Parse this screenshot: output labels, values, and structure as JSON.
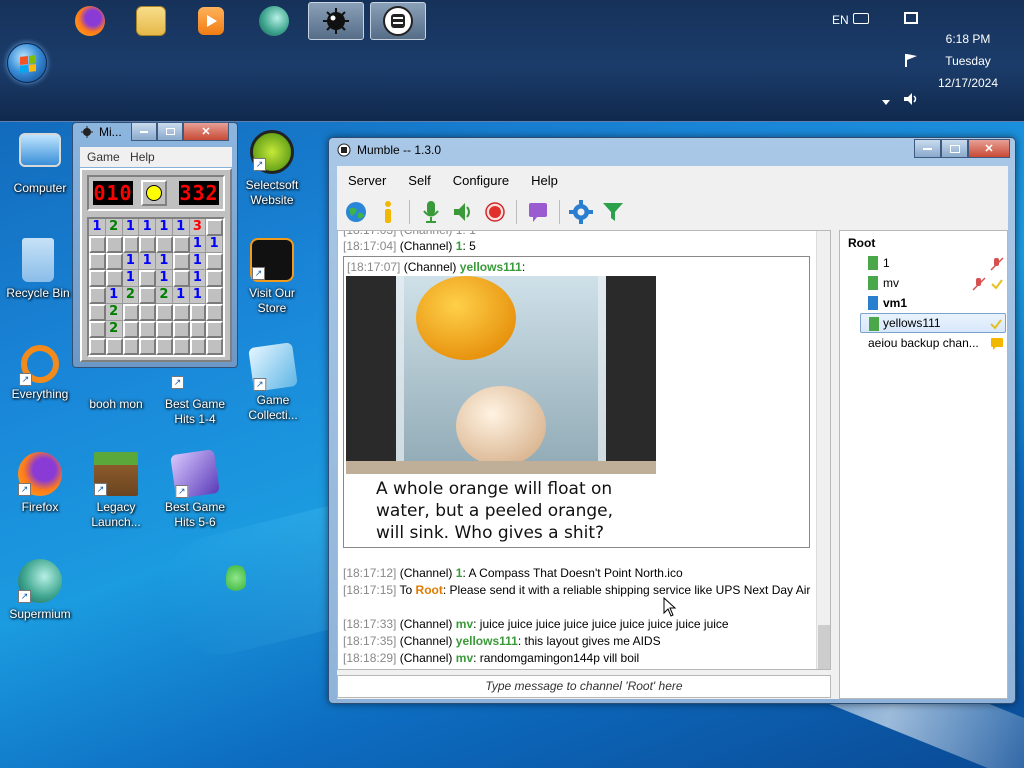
{
  "taskbar": {
    "pinned": [
      {
        "name": "firefox",
        "icon": "firefox-icon"
      },
      {
        "name": "file-explorer",
        "icon": "folder-icon"
      },
      {
        "name": "media-player",
        "icon": "media-player-icon"
      },
      {
        "name": "supermium",
        "icon": "supermium-icon"
      },
      {
        "name": "minesweeper",
        "icon": "mine-icon"
      },
      {
        "name": "mumble",
        "icon": "mumble-icon"
      }
    ],
    "language": "EN",
    "clock": {
      "time": "6:18 PM",
      "day": "Tuesday",
      "date": "12/17/2024"
    }
  },
  "desktop": {
    "icons": [
      {
        "label": "Computer"
      },
      {
        "label": "Recycle Bin"
      },
      {
        "label": "Everything"
      },
      {
        "label": "Firefox"
      },
      {
        "label": "Supermium"
      },
      {
        "label": "Selectsoft Website"
      },
      {
        "label": "Visit Our Store"
      },
      {
        "label": "booh mon"
      },
      {
        "label": "Best Game Hits 1-4"
      },
      {
        "label": "Game Collecti..."
      },
      {
        "label": "Legacy Launch..."
      },
      {
        "label": "Best Game Hits 5-6"
      }
    ]
  },
  "minesweeper": {
    "title": "Mi...",
    "menu": [
      "Game",
      "Help"
    ],
    "mines_left": "010",
    "timer": "332",
    "grid": [
      [
        "1",
        "2",
        "1",
        "1",
        "1",
        "1",
        "3",
        ""
      ],
      [
        "",
        "",
        "",
        "",
        "",
        "",
        "1",
        "1"
      ],
      [
        "",
        "",
        "1",
        "1",
        "1",
        "",
        "1",
        ""
      ],
      [
        "",
        "",
        "1",
        "",
        "1",
        "",
        "1",
        ""
      ],
      [
        "",
        "1",
        "2",
        "",
        "2",
        "1",
        "1",
        ""
      ],
      [
        "",
        "2",
        "",
        "",
        "",
        "",
        "",
        ""
      ],
      [
        "",
        "2",
        "",
        "",
        "",
        "",
        "",
        ""
      ],
      [
        "",
        "",
        "",
        "",
        "",
        "",
        "",
        ""
      ]
    ],
    "closed": [
      [
        0,
        0,
        0,
        0,
        0,
        0,
        0,
        1
      ],
      [
        1,
        1,
        1,
        1,
        1,
        1,
        0,
        0
      ],
      [
        1,
        1,
        0,
        0,
        0,
        1,
        0,
        1
      ],
      [
        1,
        1,
        0,
        1,
        0,
        1,
        0,
        1
      ],
      [
        1,
        0,
        0,
        1,
        0,
        0,
        0,
        1
      ],
      [
        1,
        0,
        1,
        1,
        1,
        1,
        1,
        1
      ],
      [
        1,
        0,
        1,
        1,
        1,
        1,
        1,
        1
      ],
      [
        1,
        1,
        1,
        1,
        1,
        1,
        1,
        1
      ]
    ]
  },
  "mumble": {
    "title": "Mumble -- 1.3.0",
    "menu": [
      "Server",
      "Self",
      "Configure",
      "Help"
    ],
    "log": {
      "partial_top": "[18:17:03] (Channel) 1: 1",
      "line1": {
        "time": "[18:17:04]",
        "scope": "(Channel)",
        "user": "1",
        "text": ": 5"
      },
      "line2": {
        "time": "[18:17:07]",
        "scope": "(Channel)",
        "user": "yellows111",
        "text": ":"
      },
      "image_caption": "A whole orange will float on water, but a peeled orange, will sink. Who gives a shit?",
      "line3": {
        "time": "[18:17:12]",
        "scope": "(Channel)",
        "user": "1",
        "text": ": A Compass That Doesn't Point North.ico"
      },
      "line4": {
        "time": "[18:17:15]",
        "scope": "To",
        "user": "Root",
        "text": ": Please send it with a reliable shipping service like UPS Next Day Air"
      },
      "line5": {
        "time": "[18:17:33]",
        "scope": "(Channel)",
        "user": "mv",
        "text": ": juice juice juice juice juice juice juice juice juice"
      },
      "line6": {
        "time": "[18:17:35]",
        "scope": "(Channel)",
        "user": "yellows111",
        "text": ": this layout gives me AIDS"
      },
      "line7": {
        "time": "[18:18:29]",
        "scope": "(Channel)",
        "user": "mv",
        "text": ": randomgamingon144p vill boil"
      }
    },
    "input_placeholder": "Type message to channel 'Root' here",
    "tree": {
      "root": "Root",
      "users": [
        {
          "name": "1"
        },
        {
          "name": "mv"
        },
        {
          "name": "vm1"
        },
        {
          "name": "yellows111"
        }
      ],
      "subchannel": "aeiou backup chan..."
    }
  },
  "colors": {
    "user_green": "#3a9a3a",
    "root_orange": "#e07b00",
    "timestamp_gray": "#888888"
  }
}
